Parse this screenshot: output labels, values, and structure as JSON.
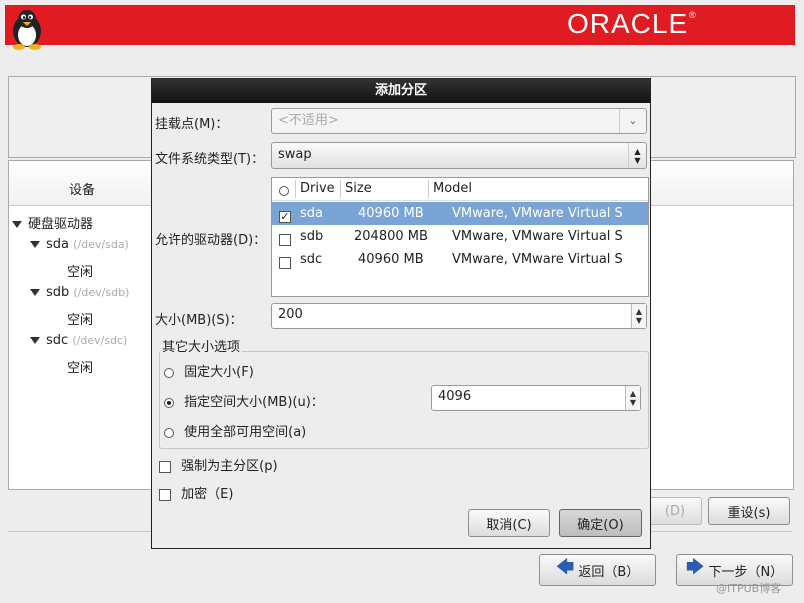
{
  "banner": {
    "brand": "ORACLE",
    "trademark": "®"
  },
  "devices": {
    "header": "设备",
    "tree": [
      {
        "label": "硬盘驱动器",
        "level": 0
      },
      {
        "label": "sda",
        "path": "(/dev/sda)",
        "level": 1
      },
      {
        "label": "空闲",
        "level": 2
      },
      {
        "label": "sdb",
        "path": "(/dev/sdb)",
        "level": 1
      },
      {
        "label": "空闲",
        "level": 2
      },
      {
        "label": "sdc",
        "path": "(/dev/sdc)",
        "level": 1
      },
      {
        "label": "空闲",
        "level": 2
      }
    ]
  },
  "actions": {
    "delete_label": "(D)",
    "reset_label": "重设(s)"
  },
  "nav": {
    "back_label": "返回（B）",
    "next_label": "下一步（N）"
  },
  "watermark": "@ITPUB博客",
  "dialog": {
    "title": "添加分区",
    "mount_label": "挂载点(M)：",
    "mount_value": "<不适用>",
    "fstype_label": "文件系统类型(T)：",
    "fstype_value": "swap",
    "drives_label": "允许的驱动器(D)：",
    "drive_columns": [
      "Drive",
      "Size",
      "Model"
    ],
    "drives": [
      {
        "drive": "sda",
        "size": "40960 MB",
        "model": "VMware, VMware Virtual S",
        "checked": true,
        "selected": true
      },
      {
        "drive": "sdb",
        "size": "204800 MB",
        "model": "VMware, VMware Virtual S",
        "checked": false,
        "selected": false
      },
      {
        "drive": "sdc",
        "size": "40960 MB",
        "model": "VMware, VMware Virtual S",
        "checked": false,
        "selected": false
      }
    ],
    "size_label": "大小(MB)(S)：",
    "size_value": "200",
    "other_options_title": "其它大小选项",
    "opt_fixed": "固定大小(F)",
    "opt_upto": "指定空间大小(MB)(u)：",
    "opt_upto_value": "4096",
    "opt_fill": "使用全部可用空间(a)",
    "selected_option": "upto",
    "force_primary": "强制为主分区(p)",
    "encrypt": "加密（E)",
    "cancel_label": "取消(C)",
    "ok_label": "确定(O)"
  }
}
